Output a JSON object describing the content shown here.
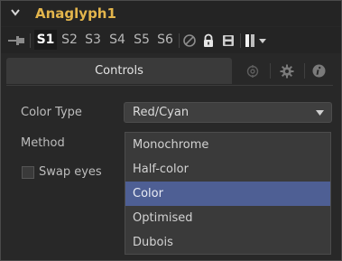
{
  "node": {
    "title": "Anaglyph1"
  },
  "versions": {
    "tabs": [
      "S1",
      "S2",
      "S3",
      "S4",
      "S5",
      "S6"
    ],
    "active_index": 0
  },
  "toolbar_icons": [
    "pin-icon",
    "disable-icon",
    "lock-icon",
    "save-icon",
    "color-swatch-icon",
    "chevron-down-icon"
  ],
  "tabs": {
    "controls_label": "Controls",
    "icons": [
      "modifiers-icon",
      "settings-gear-icon",
      "info-icon"
    ]
  },
  "controls": {
    "color_type_label": "Color Type",
    "color_type_value": "Red/Cyan",
    "method_label": "Method",
    "swap_eyes_label": "Swap eyes",
    "swap_eyes_checked": false
  },
  "method_dropdown": {
    "options": [
      "Monochrome",
      "Half-color",
      "Color",
      "Optimised",
      "Dubois"
    ],
    "selected": "Color"
  },
  "colors": {
    "title": "#e3b54c",
    "selection": "#4e5f94",
    "background": "#282828"
  }
}
